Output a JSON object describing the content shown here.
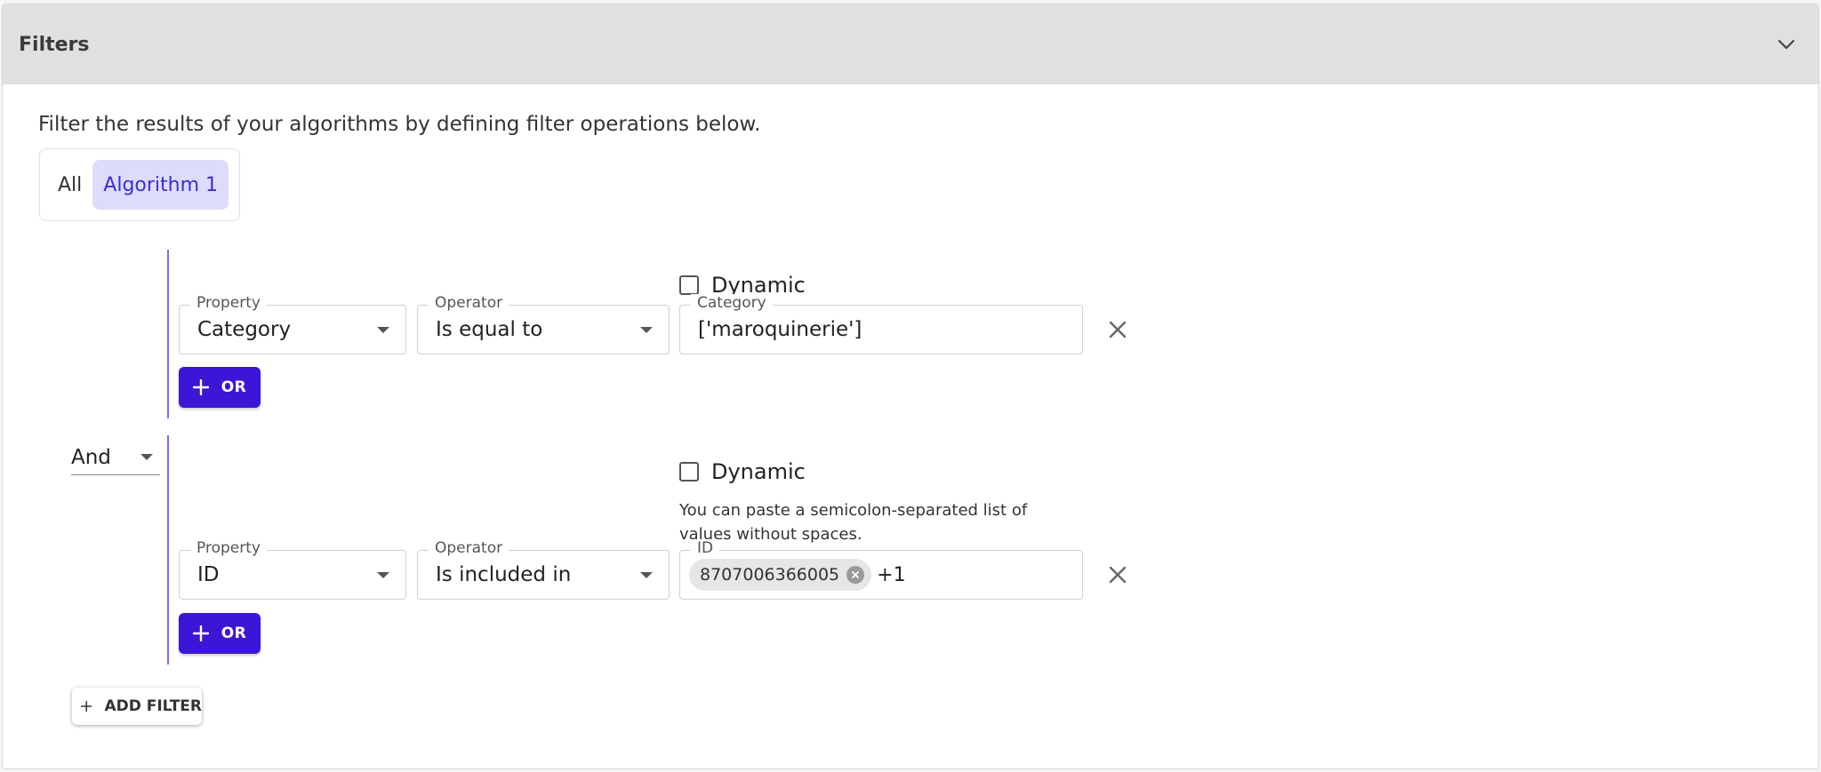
{
  "panel": {
    "title": "Filters",
    "description": "Filter the results of your algorithms by defining filter operations below."
  },
  "scope": {
    "options": [
      "All",
      "Algorithm 1"
    ],
    "selected": "Algorithm 1"
  },
  "filters": [
    {
      "property_label": "Property",
      "property_value": "Category",
      "operator_label": "Operator",
      "operator_value": "Is equal to",
      "dynamic_label": "Dynamic",
      "dynamic_checked": false,
      "value_label": "Category",
      "value": "['maroquinerie']",
      "or_label": "OR"
    },
    {
      "property_label": "Property",
      "property_value": "ID",
      "operator_label": "Operator",
      "operator_value": "Is included in",
      "dynamic_label": "Dynamic",
      "dynamic_checked": false,
      "helper_text": "You can paste a semicolon-separated list of values without spaces.",
      "value_label": "ID",
      "chips": [
        "8707006366005"
      ],
      "more_count": "+1",
      "or_label": "OR"
    }
  ],
  "logic": {
    "value": "And"
  },
  "add_filter_label": "ADD FILTER",
  "colors": {
    "accent": "#3a17d6",
    "header_bg": "#e0e0e0",
    "selected_option_bg": "#dcdcfb",
    "selected_option_text": "#3b2fd0",
    "group_line": "#7a6ef0"
  },
  "icons": {
    "collapse": "chevron-down-icon",
    "remove": "close-icon",
    "add": "plus-icon",
    "chip_remove": "cancel-circle-icon",
    "dropdown": "caret-down-icon"
  }
}
